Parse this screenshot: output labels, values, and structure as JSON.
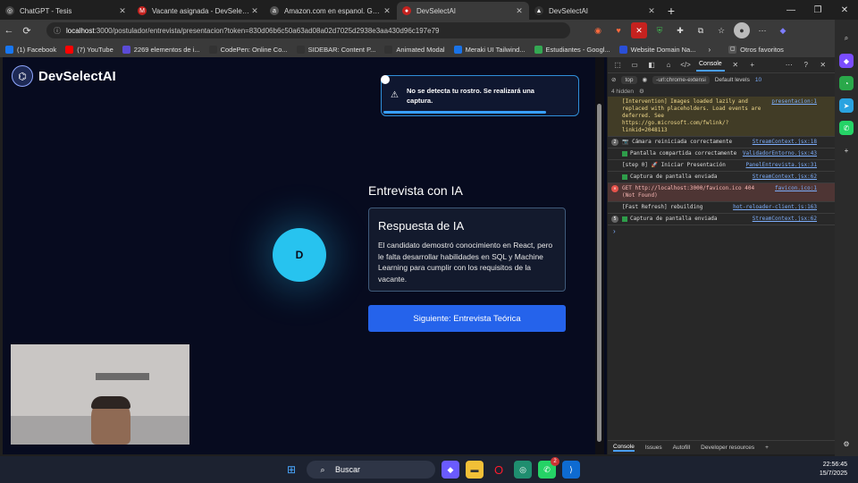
{
  "tabs": [
    {
      "label": "ChatGPT - Tesis",
      "color": "#444444",
      "glyph": "◎",
      "active": false
    },
    {
      "label": "Vacante asignada - DevSelectAI - ",
      "color": "#c5221f",
      "glyph": "M",
      "active": false
    },
    {
      "label": "Amazon.com en espanol. Gasta m",
      "color": "#555555",
      "glyph": "a",
      "active": false
    },
    {
      "label": "DevSelectAI",
      "color": "#c5221f",
      "glyph": "●",
      "active": true
    },
    {
      "label": "DevSelectAI",
      "color": "#333333",
      "glyph": "▲",
      "active": false
    }
  ],
  "address": {
    "host": "localhost",
    "path": ":3000/postulador/entrevista/presentacion?token=830d06b6c50a63ad08a02d7025d2938e3aa430d96c197e79"
  },
  "bookmarks": [
    {
      "label": "(1) Facebook",
      "color": "#1877f2"
    },
    {
      "label": "(7) YouTube",
      "color": "#ff0000"
    },
    {
      "label": "2269 elementos de i...",
      "color": "#5b4bd6"
    },
    {
      "label": "CodePen: Online Co...",
      "color": "#333333"
    },
    {
      "label": "SIDEBAR: Content P...",
      "color": "#333333"
    },
    {
      "label": "Animated Modal",
      "color": "#333333"
    },
    {
      "label": "Meraki UI Tailwind...",
      "color": "#1a73e8"
    },
    {
      "label": "Estudiantes - Googl...",
      "color": "#34a853"
    },
    {
      "label": "Website Domain Na...",
      "color": "#2a4fd7"
    }
  ],
  "bookmarks_more": "Otros favoritos",
  "app": {
    "brand": "DevSelectAI",
    "toast": "No se detecta tu rostro. Se realizará una captura.",
    "avatar_initial": "D",
    "section_title": "Entrevista con IA",
    "card_title": "Respuesta de IA",
    "card_body": "El candidato demostró conocimiento en React, pero le falta desarrollar habilidades en SQL y Machine Learning para cumplir con los requisitos de la vacante.",
    "next_button": "Siguiente: Entrevista Teórica"
  },
  "devtools": {
    "active_tab": "Console",
    "context": "top",
    "filter": "-url:chrome-extensi",
    "levels": "Default levels",
    "issue_count": "10",
    "hidden": "4 hidden",
    "logs": [
      {
        "type": "warn",
        "text": "[Intervention] Images loaded lazily and replaced with placeholders. Load events are deferred. See https://go.microsoft.com/fwlink/?linkid=2048113",
        "src": "presentacion:1"
      },
      {
        "type": "info",
        "badge": "2",
        "text": "📷 Cámara reiniciada correctamente",
        "src": "StreamContext.jsx:18"
      },
      {
        "type": "ok",
        "text": "Pantalla compartida correctamente",
        "src": "ValidadorEntorno.jsx:43"
      },
      {
        "type": "info",
        "text": "[step 0] 🚀 Iniciar Presentación",
        "src": "PanelEntrevista.jsx:31"
      },
      {
        "type": "ok",
        "text": "Captura de pantalla enviada",
        "src": "StreamContext.jsx:62"
      },
      {
        "type": "err",
        "text": "GET http://localhost:3000/favicon.ico 404 (Not Found)",
        "src": "favicon.ico:1"
      },
      {
        "type": "info",
        "text": "[Fast Refresh] rebuilding",
        "src": "hot-reloader-client.js:163"
      },
      {
        "type": "ok",
        "badge": "5",
        "text": "Captura de pantalla enviada",
        "src": "StreamContext.jsx:62"
      }
    ],
    "bottom_tabs": [
      "Console",
      "Issues",
      "Autofill",
      "Developer resources"
    ]
  },
  "taskbar": {
    "search": "Buscar",
    "time": "22:56:45",
    "date": "15/7/2025",
    "whatsapp_badge": "2"
  }
}
